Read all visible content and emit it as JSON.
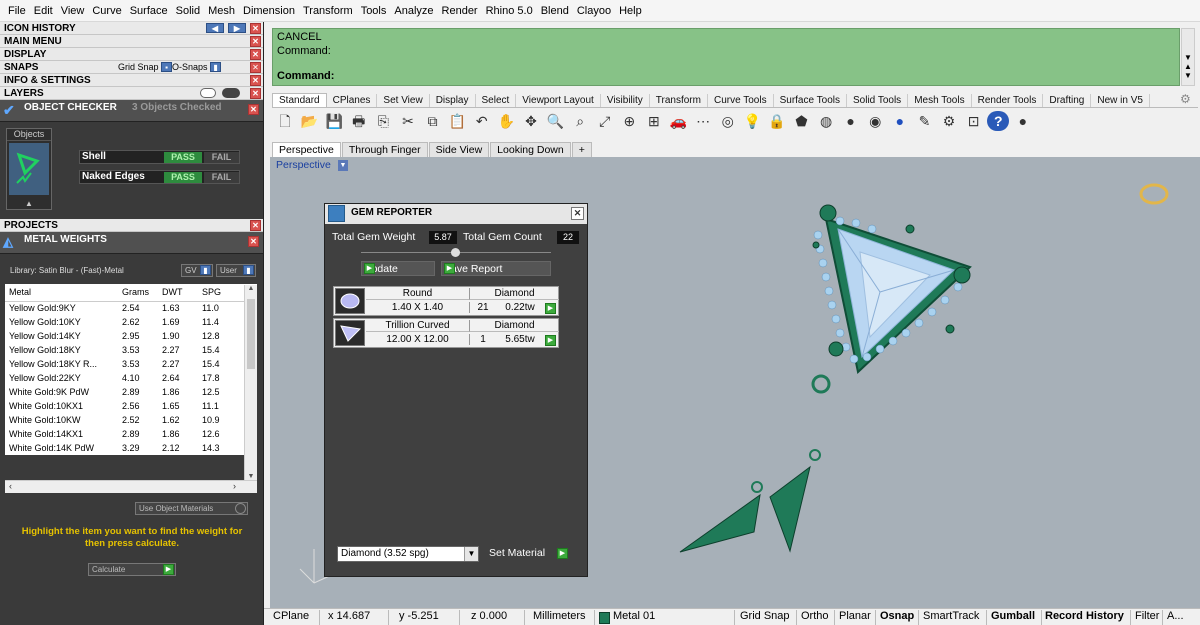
{
  "menu": [
    "File",
    "Edit",
    "View",
    "Curve",
    "Surface",
    "Solid",
    "Mesh",
    "Dimension",
    "Transform",
    "Tools",
    "Analyze",
    "Render",
    "Rhino 5.0",
    "Blend",
    "Clayoo",
    "Help"
  ],
  "left_panel": {
    "icon_history": "ICON HISTORY",
    "main_menu": "MAIN MENU",
    "display": "DISPLAY",
    "snaps": "SNAPS",
    "grid_snap": "Grid Snap",
    "o_snaps": "O-Snaps",
    "info_settings": "INFO & SETTINGS",
    "layers": "LAYERS",
    "object_checker": "OBJECT CHECKER",
    "objects_checked": "3 Objects Checked",
    "objects_label": "Objects",
    "checks": [
      {
        "name": "Shell",
        "pass": "PASS",
        "fail": "FAIL"
      },
      {
        "name": "Naked Edges",
        "pass": "PASS",
        "fail": "FAIL"
      }
    ],
    "projects": "PROJECTS",
    "metal_weights": "METAL WEIGHTS",
    "library": "Library: Satin Blur - (Fast)-Metal",
    "gv": "GV",
    "user": "User",
    "table_headers": [
      "Metal",
      "Grams",
      "DWT",
      "SPG"
    ],
    "table_rows": [
      [
        "Yellow Gold:9KY",
        "2.54",
        "1.63",
        "11.0"
      ],
      [
        "Yellow Gold:10KY",
        "2.62",
        "1.69",
        "11.4"
      ],
      [
        "Yellow Gold:14KY",
        "2.95",
        "1.90",
        "12.8"
      ],
      [
        "Yellow Gold:18KY",
        "3.53",
        "2.27",
        "15.4"
      ],
      [
        "Yellow Gold:18KY R...",
        "3.53",
        "2.27",
        "15.4"
      ],
      [
        "Yellow Gold:22KY",
        "4.10",
        "2.64",
        "17.8"
      ],
      [
        "White Gold:9K PdW",
        "2.89",
        "1.86",
        "12.5"
      ],
      [
        "White Gold:10KX1",
        "2.56",
        "1.65",
        "11.1"
      ],
      [
        "White Gold:10KW",
        "2.52",
        "1.62",
        "10.9"
      ],
      [
        "White Gold:14KX1",
        "2.89",
        "1.86",
        "12.6"
      ],
      [
        "White Gold:14K PdW",
        "3.29",
        "2.12",
        "14.3"
      ]
    ],
    "use_object_materials": "Use Object Materials",
    "hint": "Highlight the item you want to find the weight for then press calculate.",
    "calculate": "Calculate"
  },
  "command": {
    "line1": "CANCEL",
    "line2": "Command:",
    "line3": "Command:"
  },
  "toolbar_tabs": [
    "Standard",
    "CPlanes",
    "Set View",
    "Display",
    "Select",
    "Viewport Layout",
    "Visibility",
    "Transform",
    "Curve Tools",
    "Surface Tools",
    "Solid Tools",
    "Mesh Tools",
    "Render Tools",
    "Drafting",
    "New in V5"
  ],
  "toolbar_icons": [
    "new-file",
    "open-file",
    "save",
    "print",
    "import",
    "cut",
    "copy",
    "paste",
    "undo",
    "pan",
    "rotate-view",
    "zoom",
    "zoom-window",
    "zoom-extents",
    "zoom-selected",
    "four-views",
    "car",
    "select-points",
    "circle-tool",
    "bulb",
    "lock",
    "layer-material",
    "color-wheel",
    "sphere-shaded",
    "sphere-render",
    "sphere-blue",
    "pen",
    "gear-multiple",
    "grid-points",
    "help",
    "black-sphere"
  ],
  "viewport_tabs": [
    "Perspective",
    "Through Finger",
    "Side View",
    "Looking Down"
  ],
  "viewport_label": "Perspective",
  "gem_reporter": {
    "title": "GEM REPORTER",
    "total_weight_label": "Total Gem Weight",
    "total_weight": "5.87",
    "total_count_label": "Total Gem Count",
    "total_count": "22",
    "update": "Update",
    "save_report": "Save Report",
    "gems": [
      {
        "shape": "Round",
        "material": "Diamond",
        "size": "1.40 X 1.40",
        "count": "21",
        "weight": "0.22tw"
      },
      {
        "shape": "Trillion Curved",
        "material": "Diamond",
        "size": "12.00 X 12.00",
        "count": "1",
        "weight": "5.65tw"
      }
    ],
    "material_select": "Diamond    (3.52 spg)",
    "set_material": "Set Material"
  },
  "status": {
    "cplane": "CPlane",
    "x": "x 14.687",
    "y": "y -5.251",
    "z": "z 0.000",
    "units": "Millimeters",
    "layer": "Metal 01",
    "grid_snap": "Grid Snap",
    "ortho": "Ortho",
    "planar": "Planar",
    "osnap": "Osnap",
    "smarttrack": "SmartTrack",
    "gumball": "Gumball",
    "record_history": "Record History",
    "filter": "Filter",
    "more": "A..."
  },
  "colors": {
    "command_bg": "#87c287",
    "viewport_bg": "#a7b0b8",
    "jewel_green": "#1f7a58",
    "gem_blue": "#b9d6f2",
    "pass_green": "#2e8b3e",
    "hint_yellow": "#e6c200"
  }
}
